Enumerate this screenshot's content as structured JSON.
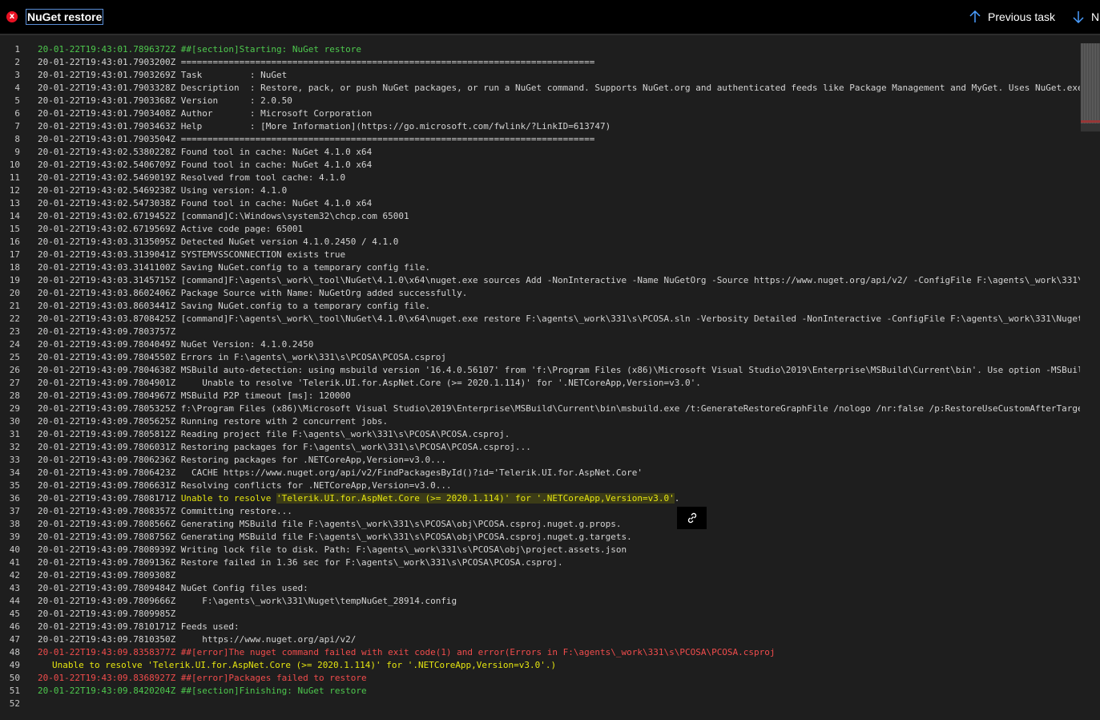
{
  "header": {
    "title": "NuGet restore",
    "status_icon": "x",
    "prev_label": "Previous task",
    "next_label": "N"
  },
  "log_lines": [
    {
      "n": "1",
      "t": "20-01-22T19:43:01.7896372Z ##[section]Starting: NuGet restore",
      "k": "section"
    },
    {
      "n": "2",
      "t": "20-01-22T19:43:01.7903200Z ==============================================================================",
      "k": ""
    },
    {
      "n": "3",
      "t": "20-01-22T19:43:01.7903269Z Task         : NuGet",
      "k": ""
    },
    {
      "n": "4",
      "t": "20-01-22T19:43:01.7903328Z Description  : Restore, pack, or push NuGet packages, or run a NuGet command. Supports NuGet.org and authenticated feeds like Package Management and MyGet. Uses NuGet.exe",
      "k": ""
    },
    {
      "n": "5",
      "t": "20-01-22T19:43:01.7903368Z Version      : 2.0.50",
      "k": ""
    },
    {
      "n": "6",
      "t": "20-01-22T19:43:01.7903408Z Author       : Microsoft Corporation",
      "k": ""
    },
    {
      "n": "7",
      "t": "20-01-22T19:43:01.7903463Z Help         : [More Information](https://go.microsoft.com/fwlink/?LinkID=613747)",
      "k": ""
    },
    {
      "n": "8",
      "t": "20-01-22T19:43:01.7903504Z ==============================================================================",
      "k": ""
    },
    {
      "n": "9",
      "t": "20-01-22T19:43:02.5380228Z Found tool in cache: NuGet 4.1.0 x64",
      "k": ""
    },
    {
      "n": "10",
      "t": "20-01-22T19:43:02.5406709Z Found tool in cache: NuGet 4.1.0 x64",
      "k": ""
    },
    {
      "n": "11",
      "t": "20-01-22T19:43:02.5469019Z Resolved from tool cache: 4.1.0",
      "k": ""
    },
    {
      "n": "12",
      "t": "20-01-22T19:43:02.5469238Z Using version: 4.1.0",
      "k": ""
    },
    {
      "n": "13",
      "t": "20-01-22T19:43:02.5473038Z Found tool in cache: NuGet 4.1.0 x64",
      "k": ""
    },
    {
      "n": "14",
      "t": "20-01-22T19:43:02.6719452Z [command]C:\\Windows\\system32\\chcp.com 65001",
      "k": ""
    },
    {
      "n": "15",
      "t": "20-01-22T19:43:02.6719569Z Active code page: 65001",
      "k": ""
    },
    {
      "n": "16",
      "t": "20-01-22T19:43:03.3135095Z Detected NuGet version 4.1.0.2450 / 4.1.0",
      "k": ""
    },
    {
      "n": "17",
      "t": "20-01-22T19:43:03.3139041Z SYSTEMVSSCONNECTION exists true",
      "k": ""
    },
    {
      "n": "18",
      "t": "20-01-22T19:43:03.3141100Z Saving NuGet.config to a temporary config file.",
      "k": ""
    },
    {
      "n": "19",
      "t": "20-01-22T19:43:03.3145715Z [command]F:\\agents\\_work\\_tool\\NuGet\\4.1.0\\x64\\nuget.exe sources Add -NonInteractive -Name NuGetOrg -Source https://www.nuget.org/api/v2/ -ConfigFile F:\\agents\\_work\\331\\",
      "k": ""
    },
    {
      "n": "20",
      "t": "20-01-22T19:43:03.8602406Z Package Source with Name: NuGetOrg added successfully.",
      "k": ""
    },
    {
      "n": "21",
      "t": "20-01-22T19:43:03.8603441Z Saving NuGet.config to a temporary config file.",
      "k": ""
    },
    {
      "n": "22",
      "t": "20-01-22T19:43:03.8708425Z [command]F:\\agents\\_work\\_tool\\NuGet\\4.1.0\\x64\\nuget.exe restore F:\\agents\\_work\\331\\s\\PCOSA.sln -Verbosity Detailed -NonInteractive -ConfigFile F:\\agents\\_work\\331\\Nuget",
      "k": ""
    },
    {
      "n": "23",
      "t": "20-01-22T19:43:09.7803757Z",
      "k": ""
    },
    {
      "n": "24",
      "t": "20-01-22T19:43:09.7804049Z NuGet Version: 4.1.0.2450",
      "k": ""
    },
    {
      "n": "25",
      "t": "20-01-22T19:43:09.7804550Z Errors in F:\\agents\\_work\\331\\s\\PCOSA\\PCOSA.csproj",
      "k": ""
    },
    {
      "n": "26",
      "t": "20-01-22T19:43:09.7804638Z MSBuild auto-detection: using msbuild version '16.4.0.56107' from 'f:\\Program Files (x86)\\Microsoft Visual Studio\\2019\\Enterprise\\MSBuild\\Current\\bin'. Use option -MSBuil",
      "k": ""
    },
    {
      "n": "27",
      "t": "20-01-22T19:43:09.7804901Z     Unable to resolve 'Telerik.UI.for.AspNet.Core (>= 2020.1.114)' for '.NETCoreApp,Version=v3.0'.",
      "k": ""
    },
    {
      "n": "28",
      "t": "20-01-22T19:43:09.7804967Z MSBuild P2P timeout [ms]: 120000",
      "k": ""
    },
    {
      "n": "29",
      "t": "20-01-22T19:43:09.7805325Z f:\\Program Files (x86)\\Microsoft Visual Studio\\2019\\Enterprise\\MSBuild\\Current\\bin\\msbuild.exe /t:GenerateRestoreGraphFile /nologo /nr:false /p:RestoreUseCustomAfterTarge",
      "k": ""
    },
    {
      "n": "30",
      "t": "20-01-22T19:43:09.7805625Z Running restore with 2 concurrent jobs.",
      "k": ""
    },
    {
      "n": "31",
      "t": "20-01-22T19:43:09.7805812Z Reading project file F:\\agents\\_work\\331\\s\\PCOSA\\PCOSA.csproj.",
      "k": ""
    },
    {
      "n": "32",
      "t": "20-01-22T19:43:09.7806031Z Restoring packages for F:\\agents\\_work\\331\\s\\PCOSA\\PCOSA.csproj...",
      "k": ""
    },
    {
      "n": "33",
      "t": "20-01-22T19:43:09.7806236Z Restoring packages for .NETCoreApp,Version=v3.0...",
      "k": ""
    },
    {
      "n": "34",
      "t": "20-01-22T19:43:09.7806423Z   CACHE https://www.nuget.org/api/v2/FindPackagesById()?id='Telerik.UI.for.AspNet.Core'",
      "k": ""
    },
    {
      "n": "35",
      "t": "20-01-22T19:43:09.7806631Z Resolving conflicts for .NETCoreApp,Version=v3.0...",
      "k": ""
    },
    {
      "n": "36",
      "t": "20-01-22T19:43:09.7808171Z Unable to resolve 'Telerik.UI.for.AspNet.Core (>= 2020.1.114)' for '.NETCoreApp,Version=v3.0'.",
      "k": "warning-hl"
    },
    {
      "n": "37",
      "t": "20-01-22T19:43:09.7808357Z Committing restore...",
      "k": ""
    },
    {
      "n": "38",
      "t": "20-01-22T19:43:09.7808566Z Generating MSBuild file F:\\agents\\_work\\331\\s\\PCOSA\\obj\\PCOSA.csproj.nuget.g.props.",
      "k": ""
    },
    {
      "n": "39",
      "t": "20-01-22T19:43:09.7808756Z Generating MSBuild file F:\\agents\\_work\\331\\s\\PCOSA\\obj\\PCOSA.csproj.nuget.g.targets.",
      "k": ""
    },
    {
      "n": "40",
      "t": "20-01-22T19:43:09.7808939Z Writing lock file to disk. Path: F:\\agents\\_work\\331\\s\\PCOSA\\obj\\project.assets.json",
      "k": ""
    },
    {
      "n": "41",
      "t": "20-01-22T19:43:09.7809136Z Restore failed in 1.36 sec for F:\\agents\\_work\\331\\s\\PCOSA\\PCOSA.csproj.",
      "k": ""
    },
    {
      "n": "42",
      "t": "20-01-22T19:43:09.7809308Z",
      "k": ""
    },
    {
      "n": "43",
      "t": "20-01-22T19:43:09.7809484Z NuGet Config files used:",
      "k": ""
    },
    {
      "n": "44",
      "t": "20-01-22T19:43:09.7809666Z     F:\\agents\\_work\\331\\Nuget\\tempNuGet_28914.config",
      "k": ""
    },
    {
      "n": "45",
      "t": "20-01-22T19:43:09.7809985Z",
      "k": ""
    },
    {
      "n": "46",
      "t": "20-01-22T19:43:09.7810171Z Feeds used:",
      "k": ""
    },
    {
      "n": "47",
      "t": "20-01-22T19:43:09.7810350Z     https://www.nuget.org/api/v2/",
      "k": ""
    },
    {
      "n": "48",
      "t": "20-01-22T19:43:09.8358377Z ##[error]The nuget command failed with exit code(1) and error(Errors in F:\\agents\\_work\\331\\s\\PCOSA\\PCOSA.csproj",
      "k": "error"
    },
    {
      "n": "49",
      "t": "Unable to resolve 'Telerik.UI.for.AspNet.Core (>= 2020.1.114)' for '.NETCoreApp,Version=v3.0'.)",
      "k": "indent"
    },
    {
      "n": "50",
      "t": "20-01-22T19:43:09.8368927Z ##[error]Packages failed to restore",
      "k": "error"
    },
    {
      "n": "51",
      "t": "20-01-22T19:43:09.8420204Z ##[section]Finishing: NuGet restore",
      "k": "section"
    },
    {
      "n": "52",
      "t": "",
      "k": ""
    }
  ],
  "colors": {
    "section": "#4ec94e",
    "error": "#f14c4c",
    "warning": "#e5e510",
    "status_failed": "#e81123"
  },
  "icons": {
    "status": "failed-x-icon",
    "prev": "arrow-up-icon",
    "next": "arrow-down-icon",
    "popup": "link-icon"
  }
}
